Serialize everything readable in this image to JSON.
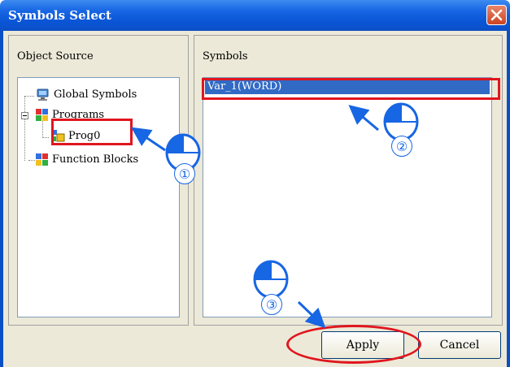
{
  "window": {
    "title": "Symbols Select"
  },
  "left_panel": {
    "label": "Object Source",
    "tree": [
      {
        "label": "Global Symbols"
      },
      {
        "label": "Programs"
      },
      {
        "label": "Prog0"
      },
      {
        "label": "Function Blocks"
      }
    ]
  },
  "right_panel": {
    "label": "Symbols",
    "items": [
      {
        "label": "Var_1(WORD)",
        "selected": true
      }
    ]
  },
  "buttons": {
    "apply": "Apply",
    "cancel": "Cancel"
  },
  "annotations": {
    "step1": "①",
    "step2": "②",
    "step3": "③"
  },
  "colors": {
    "highlight": "#e0161e",
    "annotation": "#1766e3",
    "selection": "#316ac5"
  },
  "icons": [
    "close-icon",
    "global-symbols-icon",
    "programs-icon",
    "prog-icon",
    "function-blocks-icon",
    "mouse-icon",
    "arrow-icon"
  ]
}
